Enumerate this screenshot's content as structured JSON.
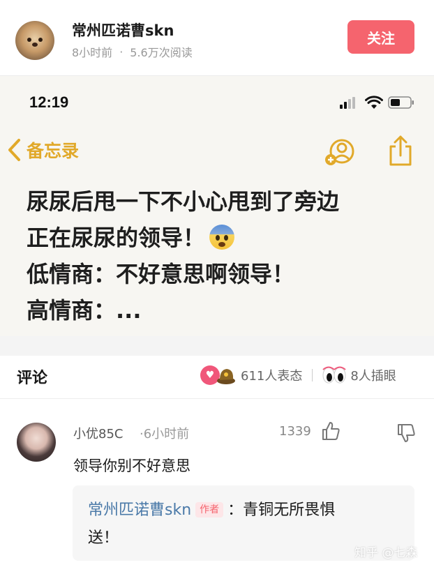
{
  "post": {
    "author_name": "常州匹诺曹skn",
    "time": "8小时前",
    "dot": "·",
    "reads": "5.6万次阅读",
    "follow_label": "关注"
  },
  "screenshot": {
    "status_time": "12:19",
    "back_label": "备忘录",
    "lines": [
      "尿尿后甩一下不小心甩到了旁边",
      "正在尿尿的领导！",
      "低情商：不好意思啊领导！",
      "高情商：..."
    ],
    "emoji": "fearful-face-emoji",
    "icons": [
      "chevron-left-icon",
      "add-person-icon",
      "share-icon",
      "signal-icon",
      "wifi-icon",
      "battery-icon"
    ]
  },
  "comments": {
    "title": "评论",
    "reaction_count": "611人表态",
    "eyes_count": "8人插眼",
    "items": [
      {
        "user": "小优85C",
        "time": "·6小时前",
        "likes": "1339",
        "text": "领导你别不好意思",
        "reply": {
          "author": "常州匹诺曹skn",
          "tag": "作者",
          "text_line1": "：青铜无所畏惧",
          "text_line2": "送！"
        }
      }
    ]
  },
  "watermark": "知乎 @七森",
  "colors": {
    "accent_pink": "#f5646e",
    "notes_yellow": "#e1a92a",
    "reply_author_blue": "#4a79a8"
  }
}
